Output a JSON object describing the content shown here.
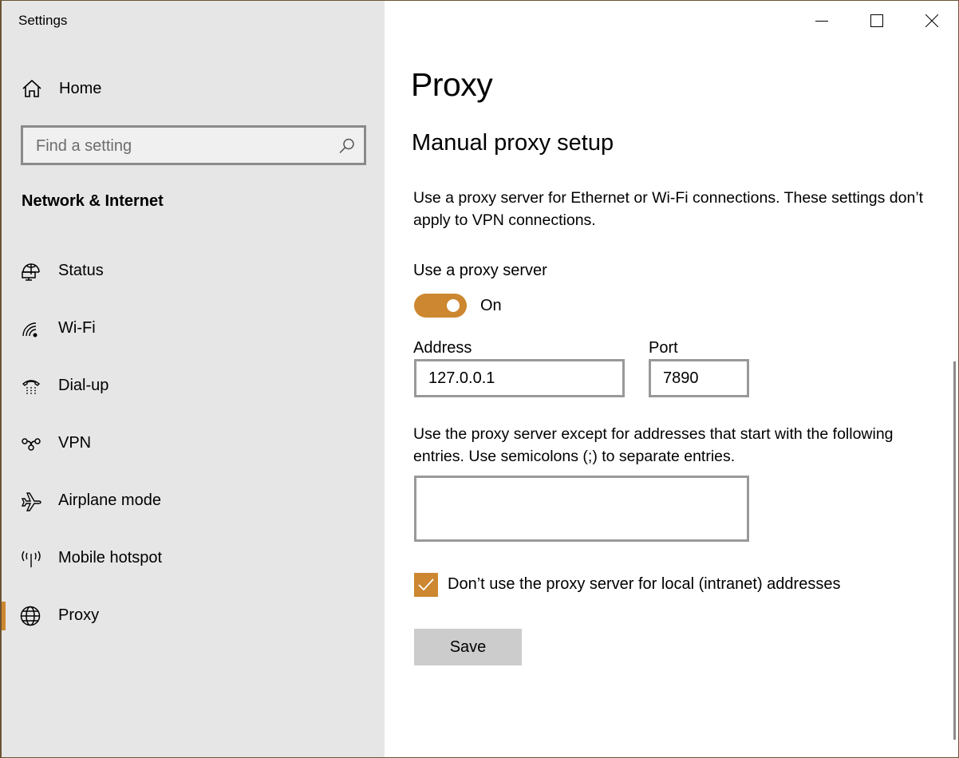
{
  "window": {
    "title": "Settings",
    "controls": {
      "minimize": "minimize-icon",
      "maximize": "maximize-icon",
      "close": "close-icon"
    }
  },
  "sidebar": {
    "home": {
      "label": "Home",
      "icon": "home-icon"
    },
    "search": {
      "placeholder": "Find a setting",
      "value": "",
      "icon": "search-icon"
    },
    "section_title": "Network & Internet",
    "items": [
      {
        "label": "Status",
        "icon": "network-status-icon",
        "selected": false
      },
      {
        "label": "Wi-Fi",
        "icon": "wifi-icon",
        "selected": false
      },
      {
        "label": "Dial-up",
        "icon": "dialup-phone-icon",
        "selected": false
      },
      {
        "label": "VPN",
        "icon": "vpn-icon",
        "selected": false
      },
      {
        "label": "Airplane mode",
        "icon": "airplane-icon",
        "selected": false
      },
      {
        "label": "Mobile hotspot",
        "icon": "hotspot-icon",
        "selected": false
      },
      {
        "label": "Proxy",
        "icon": "globe-icon",
        "selected": true
      }
    ],
    "accent_color": "#cd8730"
  },
  "main": {
    "page_title": "Proxy",
    "section_heading": "Manual proxy setup",
    "description": "Use a proxy server for Ethernet or Wi-Fi connections. These settings don’t apply to VPN connections.",
    "use_proxy": {
      "label": "Use a proxy server",
      "state_label": "On",
      "enabled": true
    },
    "address": {
      "label": "Address",
      "value": "127.0.0.1"
    },
    "port": {
      "label": "Port",
      "value": "7890"
    },
    "exceptions": {
      "description": "Use the proxy server except for addresses that start with the following entries. Use semicolons (;) to separate entries.",
      "value": ""
    },
    "local_bypass": {
      "label": "Don’t use the proxy server for local (intranet) addresses",
      "checked": true
    },
    "save_label": "Save"
  }
}
